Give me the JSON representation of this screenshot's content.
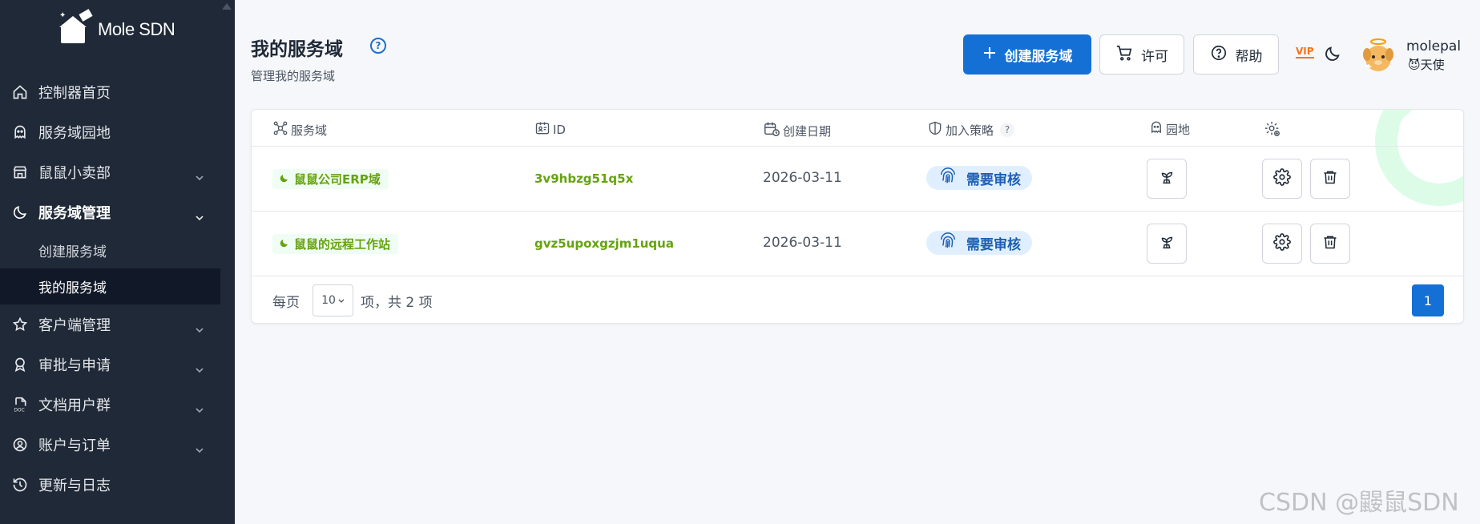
{
  "app": {
    "logo_text": "Mole SDN"
  },
  "sidebar": {
    "items": [
      {
        "label": "控制器首页",
        "icon": "home-icon"
      },
      {
        "label": "服务域园地",
        "icon": "ghost-icon"
      },
      {
        "label": "鼠鼠小卖部",
        "icon": "store-icon",
        "has_children": true
      },
      {
        "label": "服务域管理",
        "icon": "moon-icon",
        "has_children": true,
        "open": true
      },
      {
        "label": "客户端管理",
        "icon": "star-icon",
        "has_children": true
      },
      {
        "label": "审批与申请",
        "icon": "award-icon",
        "has_children": true
      },
      {
        "label": "文档用户群",
        "icon": "doc-icon",
        "has_children": true
      },
      {
        "label": "账户与订单",
        "icon": "user-circle-icon",
        "has_children": true
      },
      {
        "label": "更新与日志",
        "icon": "history-icon"
      }
    ],
    "subitems": [
      {
        "label": "创建服务域",
        "active": false
      },
      {
        "label": "我的服务域",
        "active": true
      }
    ]
  },
  "header": {
    "title": "我的服务域",
    "subtitle": "管理我的服务域",
    "create_button": "创建服务域",
    "license_button": "许可",
    "help_button": "帮助",
    "vip_label": "VIP",
    "user_name": "molepal",
    "user_role": "😈天使"
  },
  "table": {
    "columns": [
      {
        "label": "服务域",
        "icon": "network-icon"
      },
      {
        "label": "ID",
        "icon": "id-card-icon"
      },
      {
        "label": "创建日期",
        "icon": "calendar-clock-icon"
      },
      {
        "label": "加入策略",
        "icon": "shield-icon",
        "help": "?"
      },
      {
        "label": "园地",
        "icon": "ghost-icon"
      },
      {
        "label": "",
        "icon": "settings-icon"
      }
    ],
    "rows": [
      {
        "name": "鼠鼠公司ERP域",
        "id": "3v9hbzg51q5x",
        "date": "2026-03-11",
        "policy": "需要审核"
      },
      {
        "name": "鼠鼠的远程工作站",
        "id": "gvz5upoxgzjm1uqua",
        "date": "2026-03-11",
        "policy": "需要审核"
      }
    ]
  },
  "pagination": {
    "per_page_label": "每页",
    "page_size": "10",
    "total_label": "项，共 2 项",
    "current_page": "1"
  },
  "watermark": "CSDN @鼹鼠SDN",
  "colors": {
    "sidebar_bg": "#1f2937",
    "primary": "#1570d6",
    "green_text": "#65a30d",
    "vip": "#f97316"
  }
}
